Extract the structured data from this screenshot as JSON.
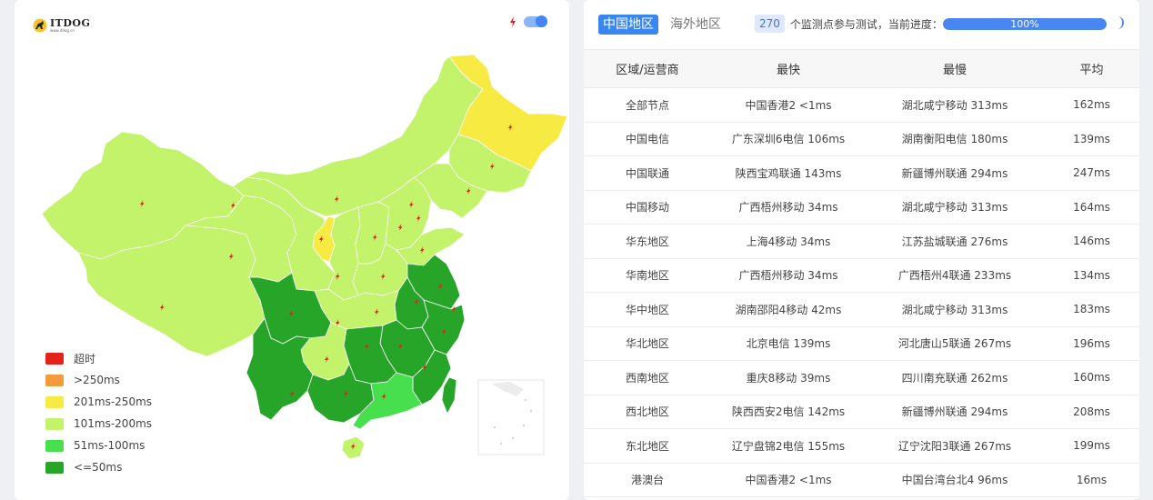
{
  "brand": {
    "logo_text": "ITDOG",
    "logo_sub": "www.itdog.cn"
  },
  "toggle": {
    "state": "on"
  },
  "colors": {
    "timeout": "#e5211c",
    "over_250": "#f39a3c",
    "c201_250": "#f6ea43",
    "c101_200": "#c3f36b",
    "c51_100": "#47df4e",
    "le_50": "#27a529",
    "accent": "#3a86ef"
  },
  "legend": [
    {
      "label": "超时",
      "color": "#e5211c"
    },
    {
      "label": ">250ms",
      "color": "#f39a3c"
    },
    {
      "label": "201ms-250ms",
      "color": "#f6ea43"
    },
    {
      "label": "101ms-200ms",
      "color": "#c3f36b"
    },
    {
      "label": "51ms-100ms",
      "color": "#47df4e"
    },
    {
      "label": "<=50ms",
      "color": "#27a529"
    }
  ],
  "tabs": [
    {
      "label": "中国地区",
      "active": true
    },
    {
      "label": "海外地区",
      "active": false
    }
  ],
  "status": {
    "count": "270",
    "text": "个监测点参与测试，当前进度：",
    "progress_label": "100%",
    "progress": 1.0
  },
  "table": {
    "headers": [
      "区域/运营商",
      "最快",
      "最慢",
      "平均"
    ],
    "rows": [
      [
        "全部节点",
        "中国香港2 <1ms",
        "湖北咸宁移动 313ms",
        "162ms"
      ],
      [
        "中国电信",
        "广东深圳6电信 106ms",
        "湖南衡阳电信 180ms",
        "139ms"
      ],
      [
        "中国联通",
        "陕西宝鸡联通 143ms",
        "新疆博州联通 294ms",
        "247ms"
      ],
      [
        "中国移动",
        "广西梧州移动 34ms",
        "湖北咸宁移动 313ms",
        "164ms"
      ],
      [
        "华东地区",
        "上海4移动 34ms",
        "江苏盐城联通 276ms",
        "146ms"
      ],
      [
        "华南地区",
        "广西梧州移动 34ms",
        "广西梧州4联通 233ms",
        "134ms"
      ],
      [
        "华中地区",
        "湖南邵阳4移动 42ms",
        "湖北咸宁移动 313ms",
        "183ms"
      ],
      [
        "华北地区",
        "北京电信 139ms",
        "河北唐山5联通 267ms",
        "196ms"
      ],
      [
        "西南地区",
        "重庆8移动 39ms",
        "四川南充联通 262ms",
        "160ms"
      ],
      [
        "西北地区",
        "陕西西安2电信 142ms",
        "新疆博州联通 294ms",
        "208ms"
      ],
      [
        "东北地区",
        "辽宁盘锦2电信 155ms",
        "辽宁沈阳3联通 267ms",
        "199ms"
      ],
      [
        "港澳台",
        "中国香港2 <1ms",
        "中国台湾台北4 96ms",
        "16ms"
      ]
    ]
  }
}
